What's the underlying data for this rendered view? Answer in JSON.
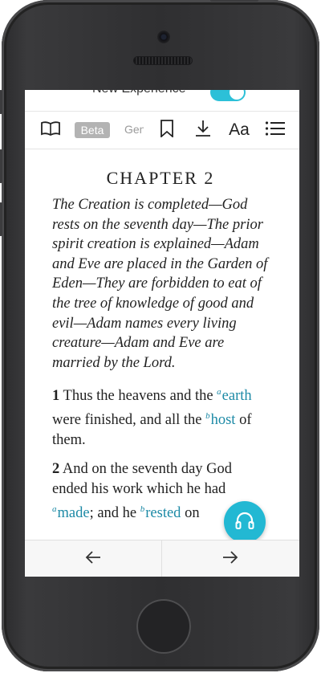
{
  "topbar": {
    "label": "New Experience",
    "toggle_on": true
  },
  "toolbar": {
    "beta_label": "Beta",
    "gen_label": "Gen",
    "font_label": "Aa",
    "icons": [
      "book-icon",
      "bookmark-icon",
      "download-icon",
      "text-size-icon",
      "list-icon"
    ]
  },
  "chapter": {
    "title": "CHAPTER 2",
    "summary": "The Creation is completed—God rests on the seventh day—The prior spirit creation is explained—Adam and Eve are placed in the Garden of Eden—They are forbidden to eat of the tree of knowledge of good and evil—Adam names every living creature—Adam and Eve are married by the Lord.",
    "verses": [
      {
        "num": "1",
        "text_a": "Thus the heavens and the",
        "fn_a": "a",
        "link_a": "earth",
        "text_b": "were finished, and all the",
        "fn_b": "b",
        "link_b": "host",
        "text_c": "of them."
      },
      {
        "num": "2",
        "text_a": "And on the seventh day God ended his work which he had",
        "fn_a": "a",
        "link_a": "made",
        "text_b": "; and he",
        "fn_b": "b",
        "link_b": "rested",
        "text_c": "on"
      }
    ]
  },
  "bottombar": {
    "prev_icon": "arrow-left-icon",
    "next_icon": "arrow-right-icon"
  },
  "fab": {
    "icon": "headphones-icon"
  },
  "colors": {
    "accent": "#22b8d3",
    "link": "#1d8aa6",
    "beta_bg": "#b3b3b3"
  }
}
